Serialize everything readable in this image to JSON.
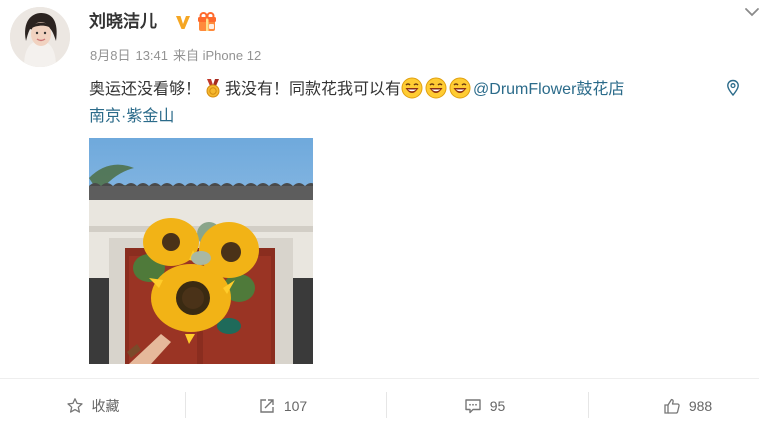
{
  "post": {
    "author": "刘晓洁儿",
    "date": "8月8日",
    "time": "13:41",
    "source": "来自 iPhone 12",
    "text_part1": "奥运还没看够！",
    "text_part2": "我没有！同款花我可以有",
    "mention": "@DrumFlower鼓花店",
    "location": "南京·紫金山"
  },
  "icons": {
    "verified": "verified-v-badge",
    "gift": "gift-badge",
    "medal": "medal-emoji",
    "laugh": "laughing-emoji",
    "location": "location-pin-icon",
    "more": "chevron-down-icon"
  },
  "actions": {
    "favorite_label": "收藏",
    "repost_count": "107",
    "comment_count": "95",
    "like_count": "988"
  },
  "colors": {
    "link": "#2b6b8a",
    "verified": "#f5a623",
    "muted": "#939393"
  }
}
